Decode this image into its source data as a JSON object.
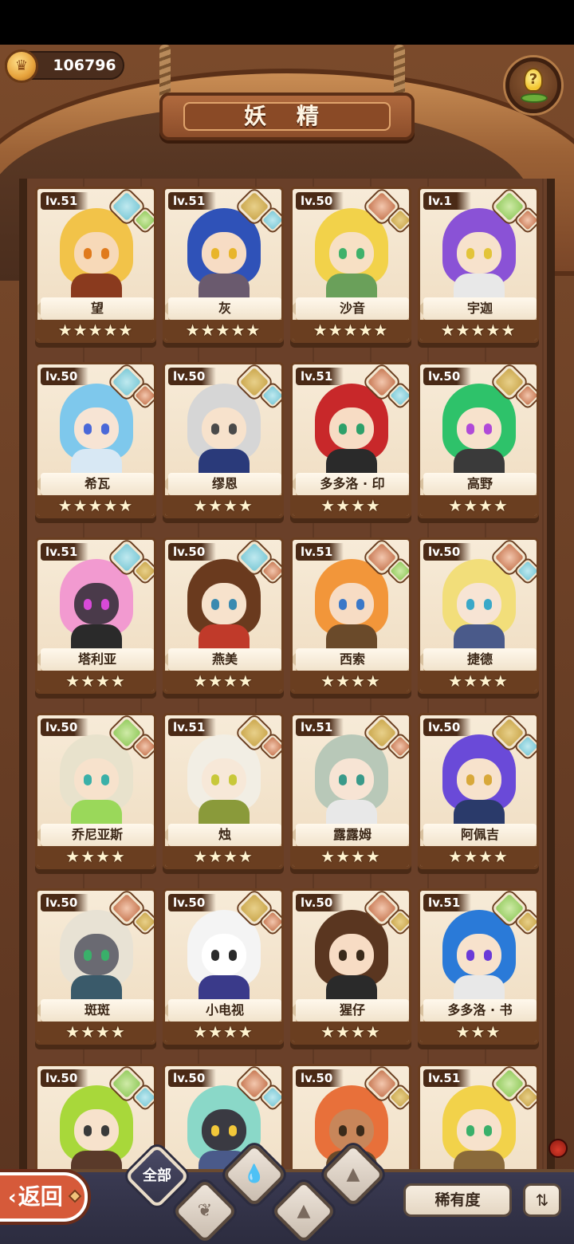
{
  "currency": {
    "value": "106796",
    "icon": "crown-coin-icon"
  },
  "title": "妖 精",
  "hint_button": {
    "icon": "lightbulb-sprout-icon"
  },
  "cards": [
    {
      "level": "lv.51",
      "name": "望",
      "stars": "★★★★★",
      "elements": [
        "water",
        "grass"
      ],
      "palette": {
        "hair": "#f2c349",
        "skin": "#f7d9b8",
        "eye": "#e07a1c",
        "outfit": "#8a3a1e"
      }
    },
    {
      "level": "lv.51",
      "name": "灰",
      "stars": "★★★★★",
      "elements": [
        "earth",
        "water"
      ],
      "palette": {
        "hair": "#2f52b8",
        "skin": "#f7dcc4",
        "eye": "#e8b52a",
        "outfit": "#6a5a6e"
      }
    },
    {
      "level": "lv.50",
      "name": "沙音",
      "stars": "★★★★★",
      "elements": [
        "fire",
        "earth"
      ],
      "palette": {
        "hair": "#f2d24a",
        "skin": "#f7e0c4",
        "eye": "#3fb16a",
        "outfit": "#6aa05a"
      }
    },
    {
      "level": "lv.1",
      "name": "宇迦",
      "stars": "★★★★★",
      "elements": [
        "grass",
        "fire"
      ],
      "palette": {
        "hair": "#8a52d6",
        "skin": "#f7e2cc",
        "eye": "#e3c43a",
        "outfit": "#e8e8e8"
      }
    },
    {
      "level": "lv.50",
      "name": "希瓦",
      "stars": "★★★★★",
      "elements": [
        "water",
        "fire"
      ],
      "palette": {
        "hair": "#7ec8ec",
        "skin": "#f7e4d4",
        "eye": "#4a68d8",
        "outfit": "#d8e8f4"
      }
    },
    {
      "level": "lv.50",
      "name": "缪恩",
      "stars": "★★★★",
      "elements": [
        "earth",
        "water"
      ],
      "palette": {
        "hair": "#d6d6d6",
        "skin": "#f7e2cc",
        "eye": "#4a4a4a",
        "outfit": "#2a3a7a"
      }
    },
    {
      "level": "lv.51",
      "name": "多多洛 · 印",
      "stars": "★★★★",
      "elements": [
        "fire",
        "water"
      ],
      "palette": {
        "hair": "#c8282a",
        "skin": "#f7dcc4",
        "eye": "#2ea06a",
        "outfit": "#2a2a2a"
      }
    },
    {
      "level": "lv.50",
      "name": "高野",
      "stars": "★★★★",
      "elements": [
        "earth",
        "fire"
      ],
      "palette": {
        "hair": "#2ec26a",
        "skin": "#f7e2cc",
        "eye": "#b04ad8",
        "outfit": "#3a3a3a"
      }
    },
    {
      "level": "lv.51",
      "name": "塔利亚",
      "stars": "★★★★",
      "elements": [
        "water",
        "earth"
      ],
      "palette": {
        "hair": "#f29ad0",
        "skin": "#4a3a4a",
        "eye": "#d84ad8",
        "outfit": "#2a2a2a"
      }
    },
    {
      "level": "lv.50",
      "name": "燕美",
      "stars": "★★★★",
      "elements": [
        "water",
        "fire"
      ],
      "palette": {
        "hair": "#6a3a1e",
        "skin": "#f7e2cc",
        "eye": "#3a8ab0",
        "outfit": "#c03a2a"
      }
    },
    {
      "level": "lv.51",
      "name": "西索",
      "stars": "★★★★",
      "elements": [
        "fire",
        "grass"
      ],
      "palette": {
        "hair": "#f2963a",
        "skin": "#f7dcc4",
        "eye": "#3a78c8",
        "outfit": "#6a4a2a"
      }
    },
    {
      "level": "lv.50",
      "name": "捷德",
      "stars": "★★★★",
      "elements": [
        "fire",
        "water"
      ],
      "palette": {
        "hair": "#f2de7a",
        "skin": "#f7e4d4",
        "eye": "#3aa8c8",
        "outfit": "#4a5a8a"
      }
    },
    {
      "level": "lv.50",
      "name": "乔尼亚斯",
      "stars": "★★★★",
      "elements": [
        "grass",
        "fire"
      ],
      "palette": {
        "hair": "#e8e2cc",
        "skin": "#f7e2cc",
        "eye": "#3ab0a8",
        "outfit": "#9ad85a"
      }
    },
    {
      "level": "lv.51",
      "name": "烛",
      "stars": "★★★★",
      "elements": [
        "earth",
        "fire"
      ],
      "palette": {
        "hair": "#f2eee4",
        "skin": "#f7e8d8",
        "eye": "#c8c83a",
        "outfit": "#8a9a3a"
      }
    },
    {
      "level": "lv.51",
      "name": "露露姆",
      "stars": "★★★★",
      "elements": [
        "earth",
        "fire"
      ],
      "palette": {
        "hair": "#b8c8b8",
        "skin": "#f7e4d4",
        "eye": "#3a9a8a",
        "outfit": "#e8e8e8"
      }
    },
    {
      "level": "lv.50",
      "name": "阿佩吉",
      "stars": "★★★★",
      "elements": [
        "earth",
        "water"
      ],
      "palette": {
        "hair": "#6a4ad8",
        "skin": "#f7e2cc",
        "eye": "#d8a83a",
        "outfit": "#2a3a6a"
      }
    },
    {
      "level": "lv.50",
      "name": "斑斑",
      "stars": "★★★★",
      "elements": [
        "fire",
        "earth"
      ],
      "palette": {
        "hair": "#e8e2d4",
        "skin": "#6a6a72",
        "eye": "#3ab06a",
        "outfit": "#3a5a6a"
      }
    },
    {
      "level": "lv.50",
      "name": "小电视",
      "stars": "★★★★",
      "elements": [
        "earth",
        "fire"
      ],
      "palette": {
        "hair": "#f4f4f4",
        "skin": "#ffffff",
        "eye": "#2a2a2a",
        "outfit": "#3a3a8a"
      }
    },
    {
      "level": "lv.50",
      "name": "猩仔",
      "stars": "★★★★",
      "elements": [
        "fire",
        "earth"
      ],
      "palette": {
        "hair": "#5a3620",
        "skin": "#f7dcc4",
        "eye": "#3a2a1a",
        "outfit": "#2a2a2a"
      }
    },
    {
      "level": "lv.51",
      "name": "多多洛 · 书",
      "stars": "★★★",
      "elements": [
        "grass",
        "earth"
      ],
      "palette": {
        "hair": "#2a7ad8",
        "skin": "#f7e2cc",
        "eye": "#6a3ad8",
        "outfit": "#e8e8e8"
      }
    },
    {
      "level": "lv.50",
      "name": "",
      "stars": "",
      "elements": [
        "grass",
        "water"
      ],
      "palette": {
        "hair": "#a8d83a",
        "skin": "#f7e2cc",
        "eye": "#3a3a3a",
        "outfit": "#5a3a2a"
      }
    },
    {
      "level": "lv.50",
      "name": "",
      "stars": "",
      "elements": [
        "fire",
        "water"
      ],
      "palette": {
        "hair": "#8ad8c8",
        "skin": "#3a3a42",
        "eye": "#f2c83a",
        "outfit": "#4a5a8a"
      }
    },
    {
      "level": "lv.50",
      "name": "",
      "stars": "",
      "elements": [
        "fire",
        "earth"
      ],
      "palette": {
        "hair": "#e8703a",
        "skin": "#c8865a",
        "eye": "#3a2a1a",
        "outfit": "#6a4a2a"
      }
    },
    {
      "level": "lv.51",
      "name": "",
      "stars": "",
      "elements": [
        "grass",
        "earth"
      ],
      "palette": {
        "hair": "#f2d24a",
        "skin": "#f7e2cc",
        "eye": "#3ab06a",
        "outfit": "#8a6a3a"
      }
    }
  ],
  "bottom": {
    "back_label": "返回",
    "filter_all_label": "全部",
    "filters": [
      "water",
      "grass",
      "earth",
      "fire"
    ],
    "rarity_label": "稀有度",
    "sort_icon": "sort-order-icon"
  },
  "colors": {
    "water": "#79c7d5",
    "earth": "#c9a54a",
    "fire": "#c4734d",
    "grass": "#8fc95a",
    "back_button": "#d65a3a"
  }
}
